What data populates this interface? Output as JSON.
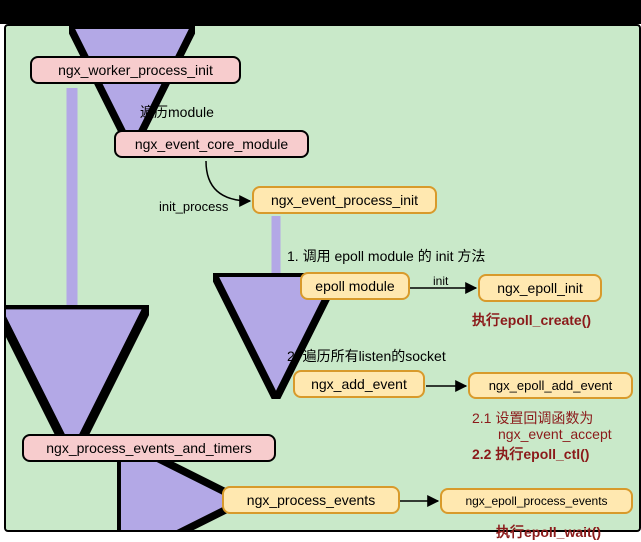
{
  "nodes": {
    "worker_init": "ngx_worker_process_init",
    "event_core_module": "ngx_event_core_module",
    "event_process_init": "ngx_event_process_init",
    "epoll_module": "epoll module",
    "epoll_init": "ngx_epoll_init",
    "add_event": "ngx_add_event",
    "epoll_add_event": "ngx_epoll_add_event",
    "process_events_and_timers": "ngx_process_events_and_timers",
    "process_events": "ngx_process_events",
    "epoll_process_events": "ngx_epoll_process_events"
  },
  "labels": {
    "iterate_module": "遍历module",
    "init_process": "init_process",
    "step1": "1. 调用 epoll module 的 init 方法",
    "init": "init",
    "exec_create": "执行epoll_create()",
    "step2": "2. 遍历所有listen的socket",
    "step2_1": "2.1 设置回调函数为",
    "step2_1b": "ngx_event_accept",
    "step2_2": "2.2 执行epoll_ctl()",
    "exec_wait": "执行epoll_wait()"
  }
}
